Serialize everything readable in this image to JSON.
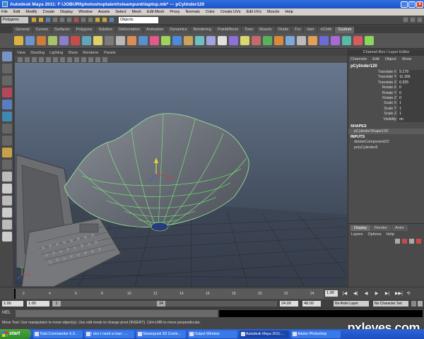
{
  "window": {
    "title": "Autodesk Maya 2011: F:\\JOBURI\\photoshoptalent\\steampunk\\laptop.mb*   ---   pCylinder120",
    "buttons": [
      "_",
      "□",
      "x"
    ]
  },
  "menubar": [
    "File",
    "Edit",
    "Modify",
    "Create",
    "Display",
    "Window",
    "Assets",
    "Select",
    "Mesh",
    "Edit Mesh",
    "Proxy",
    "Normals",
    "Color",
    "Create UVs",
    "Edit UVs",
    "Muscle",
    "Help"
  ],
  "statusline": {
    "mode": "Polygons",
    "objects_field": "Objects"
  },
  "shelf": {
    "tabs": [
      "General",
      "Curves",
      "Surfaces",
      "Polygons",
      "Subdivs",
      "Deformation",
      "Animation",
      "Dynamics",
      "Rendering",
      "PaintEffects",
      "Toon",
      "Muscle",
      "Fluids",
      "Fur",
      "Hair",
      "nCloth",
      "Custom"
    ],
    "active_tab": "Custom",
    "icon_colors": [
      "#d9b441",
      "#6d93d1",
      "#cf7c3b",
      "#a5c46a",
      "#8c7ec9",
      "#c74c4c",
      "#5fa6b8",
      "#e0d06a",
      "#7b7b7b",
      "#b8b8b8",
      "#d98e5a",
      "#5b8fcb",
      "#e05a8a",
      "#9fd35b",
      "#4c8bd9",
      "#c7a35b",
      "#6cc0c0",
      "#a2a2e0",
      "#e0e0e0",
      "#8f6fd8",
      "#d8d86f",
      "#c46a6a",
      "#5bb15b",
      "#d98a3a",
      "#7da8d8",
      "#bbbbbb",
      "#e0a05a",
      "#6a6ad8",
      "#a86ad8",
      "#5ab8a8",
      "#d85a5a",
      "#8ad85a"
    ]
  },
  "viewport": {
    "menu": [
      "View",
      "Shading",
      "Lighting",
      "Show",
      "Renderer",
      "Panels"
    ]
  },
  "channel_box": {
    "title": "Channel Box / Layer Editor",
    "menu": [
      "Channels",
      "Edit",
      "Object",
      "Show"
    ],
    "node": "pCylinder120",
    "attributes": [
      {
        "label": "Translate X",
        "value": "9.179"
      },
      {
        "label": "Translate Y",
        "value": "11.166"
      },
      {
        "label": "Translate Z",
        "value": "0.325"
      },
      {
        "label": "Rotate X",
        "value": "0"
      },
      {
        "label": "Rotate Y",
        "value": "0"
      },
      {
        "label": "Rotate Z",
        "value": "0"
      },
      {
        "label": "Scale X",
        "value": "1"
      },
      {
        "label": "Scale Y",
        "value": "1"
      },
      {
        "label": "Scale Z",
        "value": "1"
      },
      {
        "label": "Visibility",
        "value": "on"
      }
    ],
    "shapes_header": "SHAPES",
    "shape": "pCylinderShape120",
    "inputs_header": "INPUTS",
    "inputs": [
      "deleteComponent22",
      "polyCylinder8"
    ]
  },
  "layer_editor": {
    "tabs": [
      "Display",
      "Render",
      "Anim"
    ],
    "menu": [
      "Layers",
      "Options",
      "Help"
    ]
  },
  "time_slider": {
    "ticks": [
      "2",
      "4",
      "6",
      "8",
      "10",
      "12",
      "14",
      "16",
      "18",
      "20",
      "22",
      "24"
    ],
    "current_frame": "1.00",
    "playback": [
      "|◀",
      "◀|",
      "◀",
      "▶",
      "▶|",
      "▶▶|",
      "⟲"
    ]
  },
  "range_slider": {
    "start": "1.00",
    "inner_start": "1.00",
    "handle_start": "1",
    "handle_end": "24",
    "playback_end": "24.00",
    "end": "48.00",
    "anim_layer": "No Anim Layer",
    "character_set": "No Character Set"
  },
  "command_line": {
    "label": "MEL"
  },
  "help_line": "Move Tool: Use manipulator to move object(s). Use edit mode to change pivot (INSERT). Ctrl+LMB to move perpendicular.",
  "taskbar": {
    "start": "start",
    "tasks": [
      "Total Commander 6.0...",
      "I don t need a man - ...",
      "Steampunk 3D Conte...",
      "Output Window",
      "Autodesk Maya 2011:...",
      "Adobe Photoshop"
    ],
    "active_index": 4
  },
  "watermark": "pxleyes.com"
}
